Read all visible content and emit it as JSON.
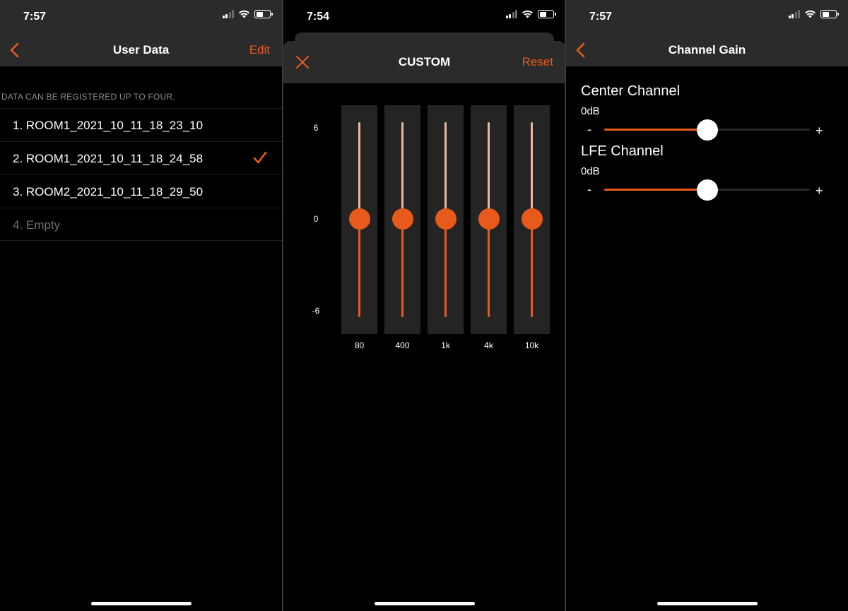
{
  "colors": {
    "accent": "#e85a1b",
    "nav_background": "#2b2b2b",
    "background": "#000000"
  },
  "screens": [
    {
      "status_time": "7:57",
      "title": "User Data",
      "edit_label": "Edit",
      "note": "DATA CAN BE REGISTERED UP TO FOUR.",
      "items": [
        {
          "label": "1. ROOM1_2021_10_11_18_23_10",
          "selected": false
        },
        {
          "label": "2. ROOM1_2021_10_11_18_24_58",
          "selected": true
        },
        {
          "label": "3. ROOM2_2021_10_11_18_29_50",
          "selected": false
        },
        {
          "label": "4. Empty",
          "selected": false
        }
      ]
    },
    {
      "status_time": "7:54",
      "title": "CUSTOM",
      "reset_label": "Reset",
      "axis": [
        "6",
        "0",
        "-6"
      ],
      "bands": [
        {
          "freq": "80",
          "value": 0
        },
        {
          "freq": "400",
          "value": 0
        },
        {
          "freq": "1k",
          "value": 0
        },
        {
          "freq": "4k",
          "value": 0
        },
        {
          "freq": "10k",
          "value": 0
        }
      ]
    },
    {
      "status_time": "7:57",
      "title": "Channel Gain",
      "channels": [
        {
          "name": "Center Channel",
          "value": "0dB",
          "level": 0.5
        },
        {
          "name": "LFE Channel",
          "value": "0dB",
          "level": 0.5
        }
      ],
      "minus_label": "-",
      "plus_label": "+"
    }
  ]
}
